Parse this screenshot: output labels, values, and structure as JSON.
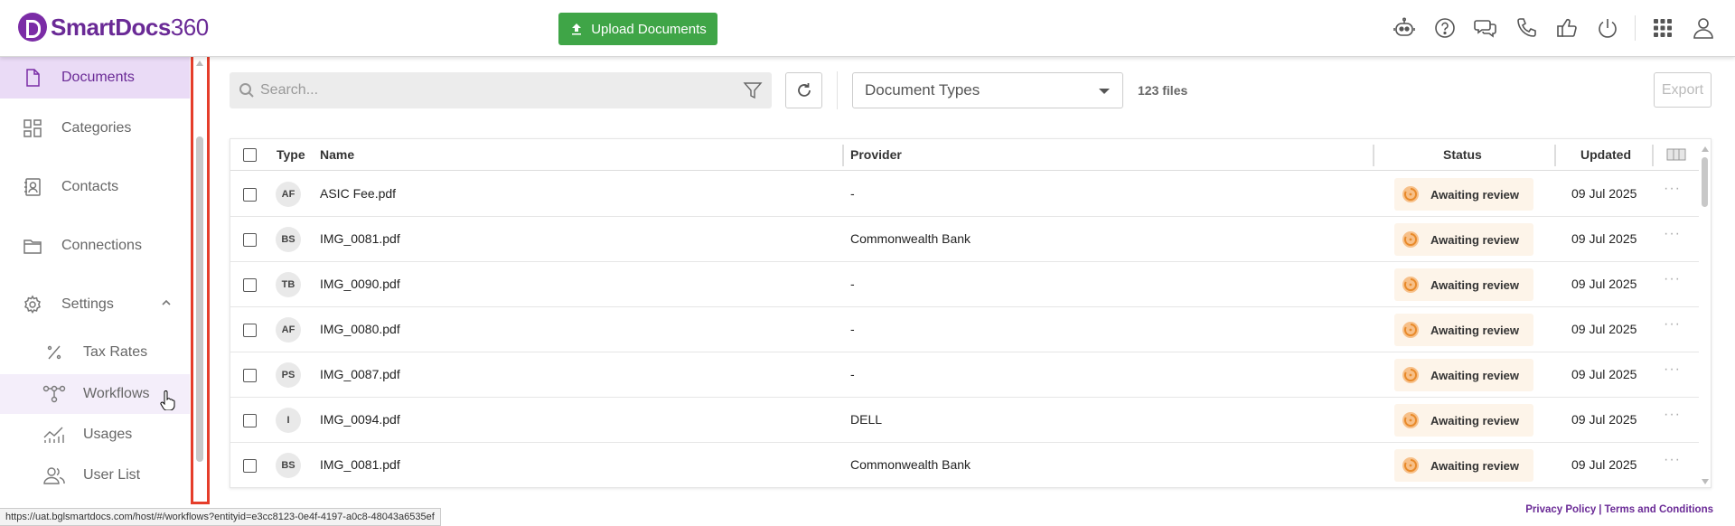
{
  "app": {
    "brand_name": "SmartDocs",
    "brand_number": "360"
  },
  "header": {
    "upload_label": "Upload Documents",
    "icons": [
      "robot-icon",
      "help-icon",
      "chat-icon",
      "phone-icon",
      "thumbs-up-icon",
      "power-icon",
      "apps-grid-icon",
      "user-icon"
    ]
  },
  "sidebar": {
    "items": [
      {
        "label": "Documents",
        "icon": "document-icon",
        "active": true
      },
      {
        "label": "Categories",
        "icon": "categories-icon"
      },
      {
        "label": "Contacts",
        "icon": "contacts-icon"
      },
      {
        "label": "Connections",
        "icon": "folder-icon"
      },
      {
        "label": "Settings",
        "icon": "gear-icon",
        "expanded": true
      }
    ],
    "sub_items": [
      {
        "label": "Tax Rates",
        "icon": "percent-icon"
      },
      {
        "label": "Workflows",
        "icon": "workflow-icon",
        "hover": true
      },
      {
        "label": "Usages",
        "icon": "usage-chart-icon"
      },
      {
        "label": "User List",
        "icon": "users-icon"
      }
    ]
  },
  "toolbar": {
    "search_placeholder": "Search...",
    "document_types_label": "Document Types",
    "file_count": "123 files",
    "export_label": "Export"
  },
  "table": {
    "headers": {
      "type": "Type",
      "name": "Name",
      "provider": "Provider",
      "status": "Status",
      "updated": "Updated"
    },
    "rows": [
      {
        "type": "AF",
        "name": "ASIC Fee.pdf",
        "provider": "-",
        "status": "Awaiting review",
        "updated": "09 Jul 2025"
      },
      {
        "type": "BS",
        "name": "IMG_0081.pdf",
        "provider": "Commonwealth Bank",
        "status": "Awaiting review",
        "updated": "09 Jul 2025"
      },
      {
        "type": "TB",
        "name": "IMG_0090.pdf",
        "provider": "-",
        "status": "Awaiting review",
        "updated": "09 Jul 2025"
      },
      {
        "type": "AF",
        "name": "IMG_0080.pdf",
        "provider": "-",
        "status": "Awaiting review",
        "updated": "09 Jul 2025"
      },
      {
        "type": "PS",
        "name": "IMG_0087.pdf",
        "provider": "-",
        "status": "Awaiting review",
        "updated": "09 Jul 2025"
      },
      {
        "type": "I",
        "name": "IMG_0094.pdf",
        "provider": "DELL",
        "status": "Awaiting review",
        "updated": "09 Jul 2025"
      },
      {
        "type": "BS",
        "name": "IMG_0081.pdf",
        "provider": "Commonwealth Bank",
        "status": "Awaiting review",
        "updated": "09 Jul 2025"
      }
    ]
  },
  "statusbar": {
    "url": "https://uat.bglsmartdocs.com/host/#/workflows?entityid=e3cc8123-0e4f-4197-a0c8-48043a6535ef"
  },
  "footer": {
    "privacy": "Privacy Policy",
    "separator": "|",
    "terms": "Terms and Conditions"
  },
  "colors": {
    "brand": "#6a2a96",
    "upload_green": "#3fa547",
    "active_nav_bg": "#eadbf6",
    "status_bg": "#fdf4e9",
    "highlight_red": "#e53d2a"
  }
}
